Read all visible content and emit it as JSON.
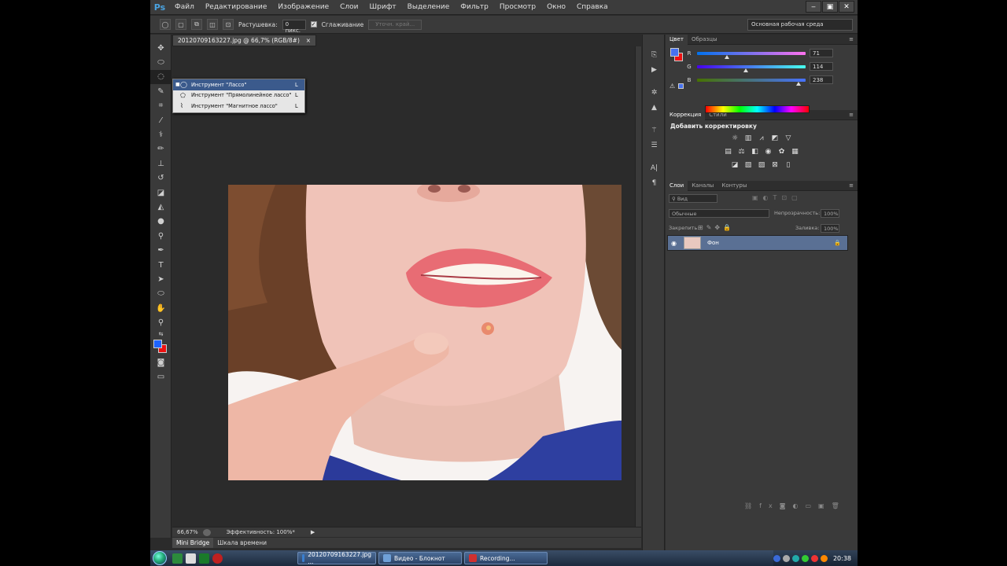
{
  "menubar": {
    "logo": "Ps",
    "items": [
      "Файл",
      "Редактирование",
      "Изображение",
      "Слои",
      "Шрифт",
      "Выделение",
      "Фильтр",
      "Просмотр",
      "Окно",
      "Справка"
    ],
    "window_buttons": [
      "‒",
      "▣",
      "✕"
    ]
  },
  "options_bar": {
    "feather_label": "Растушевка:",
    "feather_value": "0 пикс.",
    "antialias_label": "Сглаживание",
    "refine_edge_label": "Уточн. край...",
    "workspace": "Основная рабочая среда"
  },
  "document": {
    "tab_title": "20120709163227.jpg @ 66,7% (RGB/8#)",
    "tab_close": "×",
    "zoom": "66,67%",
    "efficiency": "Эффективность: 100%*"
  },
  "flyout": {
    "items": [
      {
        "label": "Инструмент \"Лассо\"",
        "key": "L",
        "selected": true
      },
      {
        "label": "Инструмент \"Прямолинейное лассо\"",
        "key": "L",
        "selected": false
      },
      {
        "label": "Инструмент \"Магнитное лассо\"",
        "key": "L",
        "selected": false
      }
    ]
  },
  "bottom_tabs": [
    "Mini Bridge",
    "Шкала времени"
  ],
  "color_panel": {
    "tabs": [
      "Цвет",
      "Образцы"
    ],
    "r_label": "R",
    "r_value": "71",
    "g_label": "G",
    "g_value": "114",
    "b_label": "B",
    "b_value": "238",
    "foreground": "#4772ee",
    "background": "#e11111"
  },
  "adjustments_panel": {
    "tabs": [
      "Коррекция",
      "Стили"
    ],
    "heading": "Добавить корректировку"
  },
  "layers_panel": {
    "tabs": [
      "Слои",
      "Каналы",
      "Контуры"
    ],
    "filter_label": "Вид",
    "blend_mode": "Обычные",
    "opacity_label": "Непрозрачность:",
    "opacity_value": "100%",
    "lock_label": "Закрепить:",
    "fill_label": "Заливка:",
    "fill_value": "100%",
    "layer_name": "Фон"
  },
  "taskbar": {
    "items": [
      {
        "label": "20120709163227.jpg ...",
        "color": "#3a7fd0"
      },
      {
        "label": "Видео - Блокнот",
        "color": "#6fa0d8"
      },
      {
        "label": "Recording...",
        "color": "#d03030"
      }
    ],
    "clock": "20:38"
  }
}
